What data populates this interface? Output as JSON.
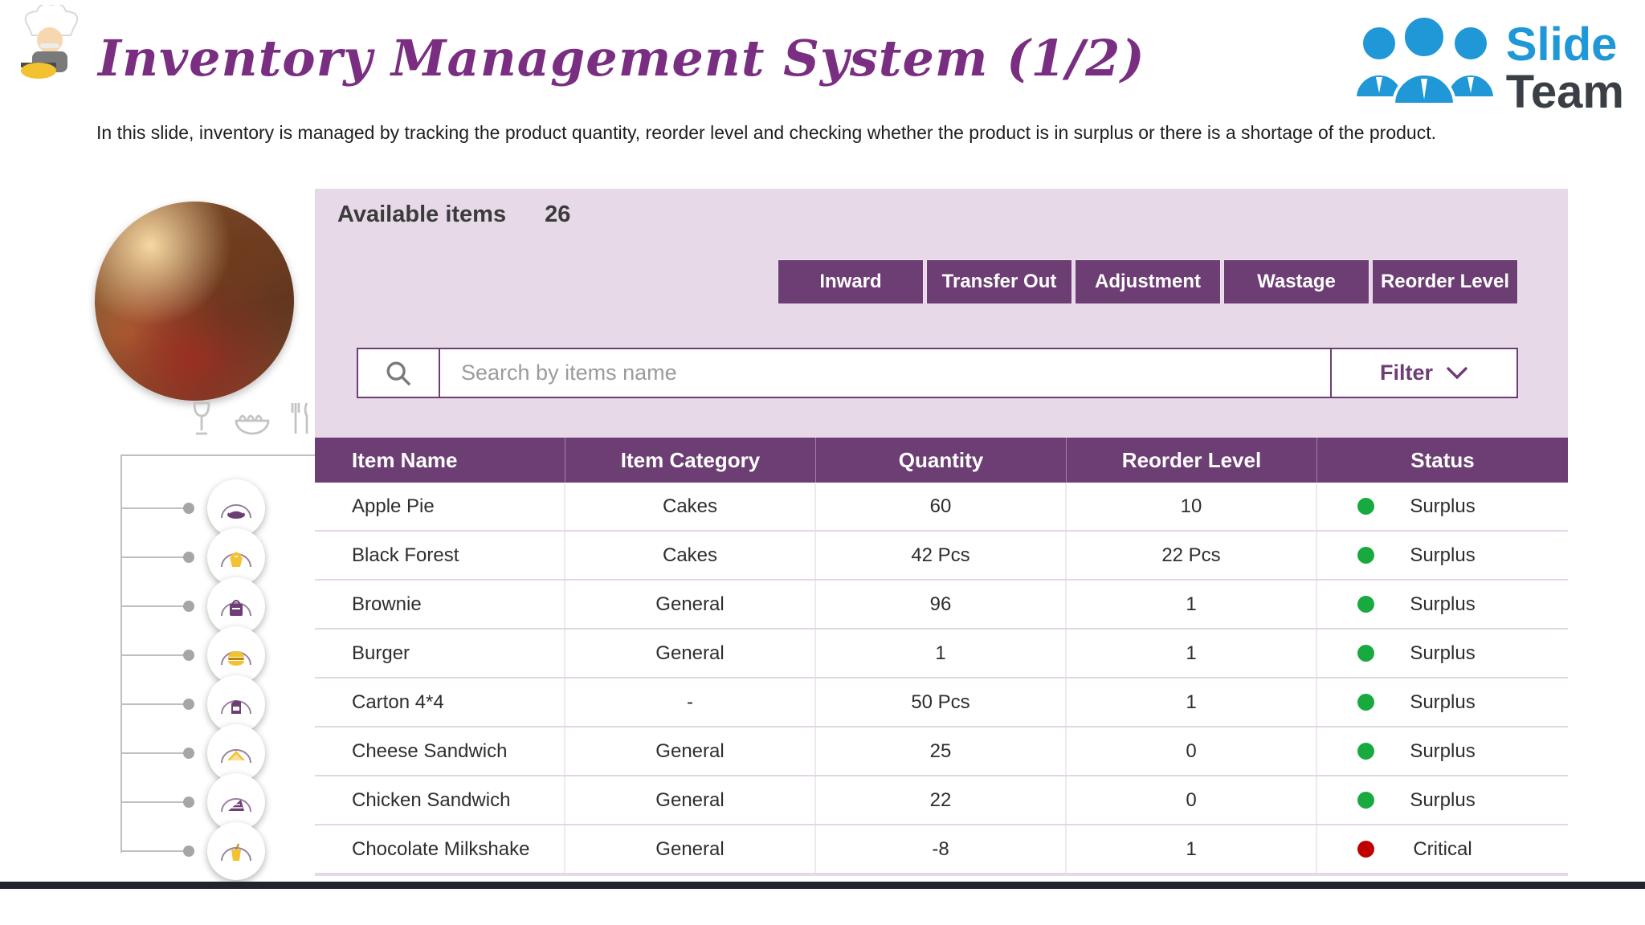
{
  "header": {
    "title": "Inventory Management System (1/2)",
    "subtitle": "In this slide, inventory is managed by tracking the product quantity, reorder level and checking whether the product is in surplus or there is a shortage of the product."
  },
  "brand": {
    "slide": "Slide",
    "team": "Team"
  },
  "panel": {
    "available_label": "Available items",
    "available_count": "26",
    "actions": [
      "Inward",
      "Transfer Out",
      "Adjustment",
      "Wastage",
      "Reorder Level"
    ],
    "search_placeholder": "Search by items name",
    "filter_label": "Filter"
  },
  "table": {
    "columns": [
      "Item Name",
      "Item Category",
      "Quantity",
      "Reorder Level",
      "Status"
    ],
    "rows": [
      {
        "name": "Apple Pie",
        "category": "Cakes",
        "quantity": "60",
        "reorder": "10",
        "status": "Surplus",
        "state": "green"
      },
      {
        "name": "Black Forest",
        "category": "Cakes",
        "quantity": "42 Pcs",
        "reorder": "22 Pcs",
        "status": "Surplus",
        "state": "green"
      },
      {
        "name": "Brownie",
        "category": "General",
        "quantity": "96",
        "reorder": "1",
        "status": "Surplus",
        "state": "green"
      },
      {
        "name": "Burger",
        "category": "General",
        "quantity": "1",
        "reorder": "1",
        "status": "Surplus",
        "state": "green"
      },
      {
        "name": "Carton 4*4",
        "category": "-",
        "quantity": "50 Pcs",
        "reorder": "1",
        "status": "Surplus",
        "state": "green"
      },
      {
        "name": "Cheese Sandwich",
        "category": "General",
        "quantity": "25",
        "reorder": "0",
        "status": "Surplus",
        "state": "green"
      },
      {
        "name": "Chicken Sandwich",
        "category": "General",
        "quantity": "22",
        "reorder": "0",
        "status": "Surplus",
        "state": "green"
      },
      {
        "name": "Chocolate Milkshake",
        "category": "General",
        "quantity": "-8",
        "reorder": "1",
        "status": "Critical",
        "state": "red"
      }
    ]
  },
  "sidebar": {
    "icons": [
      "pie-icon",
      "cupcake-icon",
      "shopping-bag-icon",
      "burger-icon",
      "milk-carton-icon",
      "sandwich-icon",
      "cake-slice-icon",
      "drink-cup-icon"
    ]
  },
  "colors": {
    "accent_purple": "#6C3E73",
    "title_purple": "#7A2E82",
    "panel_bg": "#E7D9E8",
    "status_green": "#18A93F",
    "status_red": "#C00000",
    "brand_blue": "#2097D6"
  }
}
